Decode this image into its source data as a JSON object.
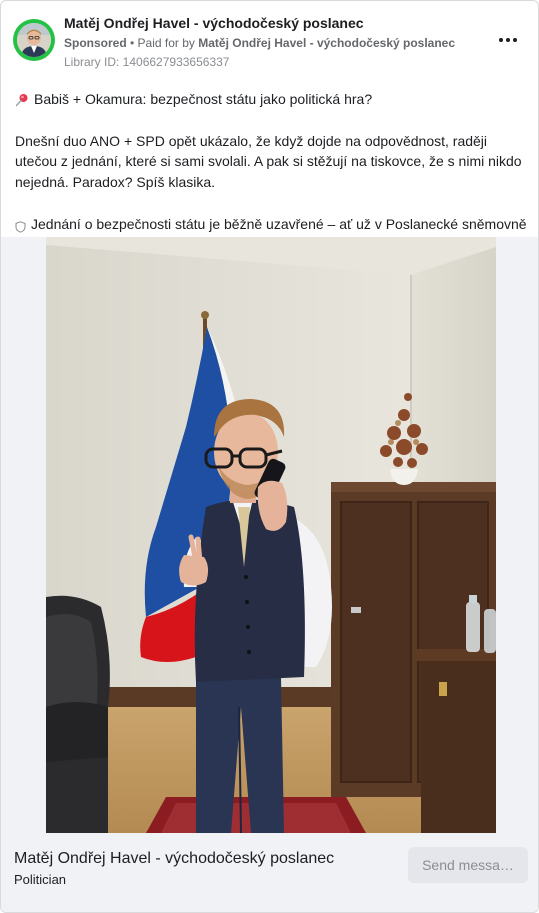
{
  "header": {
    "advertiser_name": "Matěj Ondřej Havel - východočeský poslanec",
    "sponsored_label": "Sponsored",
    "paid_for_prefix": " • Paid for by ",
    "payer_name": "Matěj Ondřej Havel - východočeský poslanec",
    "library_id": "Library ID: 1406627933656337"
  },
  "post": {
    "headline": "Babiš + Okamura: bezpečnost státu jako politická hra?",
    "paragraph": "Dnešní duo ANO + SPD opět ukázalo, že když dojde na odpovědnost, raději utečou z jednání, které si sami svolali. A pak si stěžují na tiskovce, že s nimi nikdo nejedná. Paradox? Spíš klasika.",
    "truncated_line": "Jednání o bezpečnosti státu je běžně uzavřené – ať už v Poslanecké sněmovně…"
  },
  "icons": {
    "pin": "pushpin-icon",
    "shield": "shield-icon",
    "more": "more-options-icon"
  },
  "footer": {
    "page_name": "Matěj Ondřej Havel - východočeský poslanec",
    "category": "Politician",
    "send_button_label": "Send messa…"
  },
  "colors": {
    "avatar_ring": "#23c244",
    "footer_bg": "#f0f2f5",
    "button_bg": "#e4e6eb"
  }
}
